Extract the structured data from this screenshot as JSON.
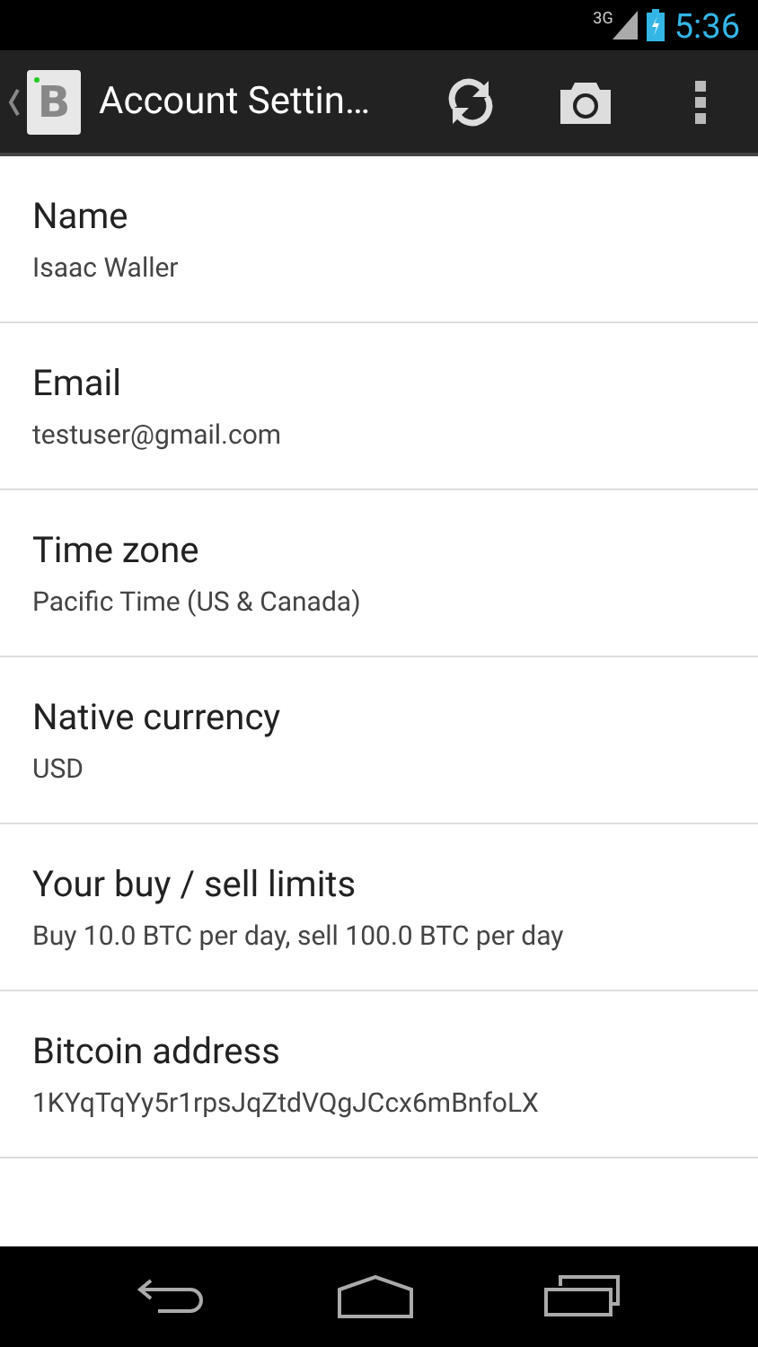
{
  "status_bar": {
    "network": "3G",
    "time": "5:36"
  },
  "action_bar": {
    "app_glyph": "B",
    "title": "Account Settin…"
  },
  "settings": [
    {
      "title": "Name",
      "value": "Isaac Waller"
    },
    {
      "title": "Email",
      "value": "testuser@gmail.com"
    },
    {
      "title": "Time zone",
      "value": "Pacific Time (US & Canada)"
    },
    {
      "title": "Native currency",
      "value": "USD"
    },
    {
      "title": "Your buy / sell limits",
      "value": "Buy 10.0 BTC per day, sell 100.0 BTC per day"
    },
    {
      "title": "Bitcoin address",
      "value": "1KYqTqYy5r1rpsJqZtdVQgJCcx6mBnfoLX"
    }
  ]
}
